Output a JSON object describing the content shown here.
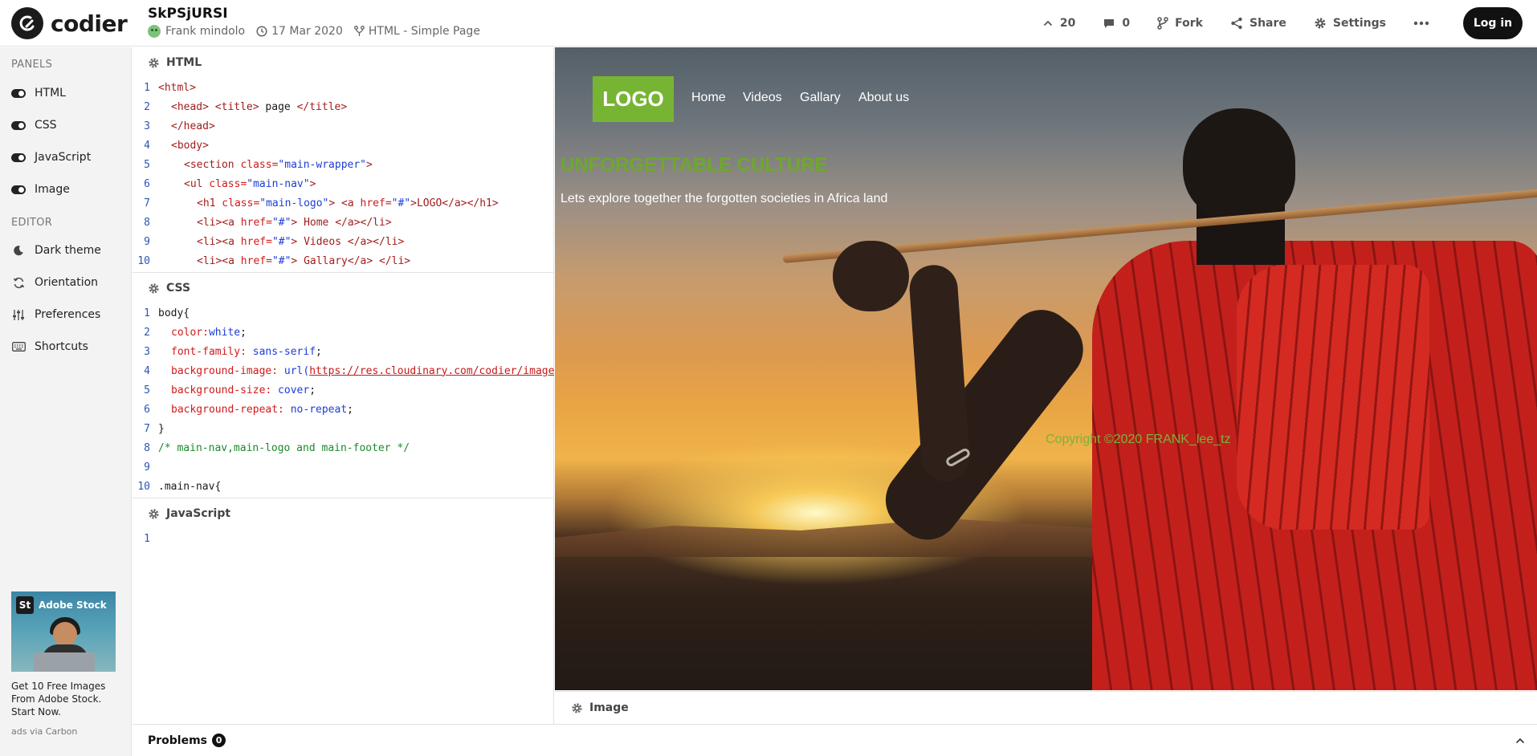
{
  "header": {
    "brand": "codier",
    "pen_title": "SkPSjURSI",
    "author": "Frank mindolo",
    "date": "17 Mar 2020",
    "template": "HTML - Simple Page",
    "likes": "20",
    "comments": "0",
    "fork_label": "Fork",
    "share_label": "Share",
    "settings_label": "Settings",
    "login_label": "Log in"
  },
  "sidebar": {
    "panels_heading": "PANELS",
    "panels": [
      {
        "label": "HTML",
        "on": true
      },
      {
        "label": "CSS",
        "on": true
      },
      {
        "label": "JavaScript",
        "on": true
      },
      {
        "label": "Image",
        "on": true
      }
    ],
    "editor_heading": "EDITOR",
    "editor_items": [
      {
        "label": "Dark theme",
        "icon": "moon-icon"
      },
      {
        "label": "Orientation",
        "icon": "rotate-icon"
      },
      {
        "label": "Preferences",
        "icon": "sliders-icon"
      },
      {
        "label": "Shortcuts",
        "icon": "keyboard-icon"
      }
    ],
    "ad": {
      "logo_letters": "St",
      "brand": "Adobe Stock",
      "text": "Get 10 Free Images From Adobe Stock. Start Now.",
      "via": "ads via Carbon"
    }
  },
  "panes": {
    "html": {
      "title": "HTML",
      "line_numbers": [
        "1",
        "2",
        "3",
        "4",
        "5",
        "6",
        "7",
        "8",
        "9",
        "10"
      ],
      "lines": {
        "l1_tag": "<html>",
        "l2_tag1": "<head>",
        "l2_tag2": " <title>",
        "l2_text": " page ",
        "l2_tag3": "</title>",
        "l3_tag": "</head>",
        "l4_tag": "<body>",
        "l5_open": "<section",
        "l5_attr": " class=",
        "l5_val": "\"main-wrapper\"",
        "l5_close": ">",
        "l6_open": "<ul",
        "l6_attr": " class=",
        "l6_val": "\"main-nav\"",
        "l6_close": ">",
        "l7_open": "<h1",
        "l7_attr": " class=",
        "l7_val": "\"main-logo\"",
        "l7_mid": "> <a",
        "l7_attr2": " href=",
        "l7_val2": "\"#\"",
        "l7_rest": ">LOGO</a></h1>",
        "l8_open": "<li><a",
        "l8_attr": " href=",
        "l8_val": "\"#\"",
        "l8_rest": "> Home </a></li>",
        "l9_open": "<li><a",
        "l9_attr": " href=",
        "l9_val": "\"#\"",
        "l9_rest": "> Videos </a></li>",
        "l10_open": "<li><a",
        "l10_attr": " href=",
        "l10_val": "\"#\"",
        "l10_rest": "> Gallary</a> </li>"
      }
    },
    "css": {
      "title": "CSS",
      "line_numbers": [
        "1",
        "2",
        "3",
        "4",
        "5",
        "6",
        "7",
        "8",
        "9",
        "10"
      ],
      "lines": {
        "l1": "body{",
        "l2_prop": "color:",
        "l2_val": "white",
        "l3_prop": "font-family:",
        "l3_val": " sans-serif",
        "l4_prop": "background-image:",
        "l4_fn": " url(",
        "l4_url": "https://res.cloudinary.com/codier/image/upload",
        "l5_prop": "background-size:",
        "l5_val": " cover",
        "l6_prop": "background-repeat:",
        "l6_val": " no-repeat",
        "l7": "}",
        "l8": "/* main-nav,main-logo and main-footer */",
        "l9": "",
        "l10": ".main-nav{"
      }
    },
    "js": {
      "title": "JavaScript",
      "line_numbers": [
        "1"
      ]
    },
    "image": {
      "title": "Image"
    }
  },
  "preview": {
    "logo": "LOGO",
    "nav": [
      "Home",
      "Videos",
      "Gallary",
      "About us"
    ],
    "heading": "UNFORGETTABLE CULTURE",
    "subheading": "Lets explore together the forgotten societies in Africa land",
    "footer": "Copyright ©2020 FRANK_lee_tz",
    "colors": {
      "logo_bg": "#78b434",
      "heading": "#6ea82c",
      "footer": "#7ab33a"
    }
  },
  "problems": {
    "label": "Problems",
    "count": "0"
  }
}
